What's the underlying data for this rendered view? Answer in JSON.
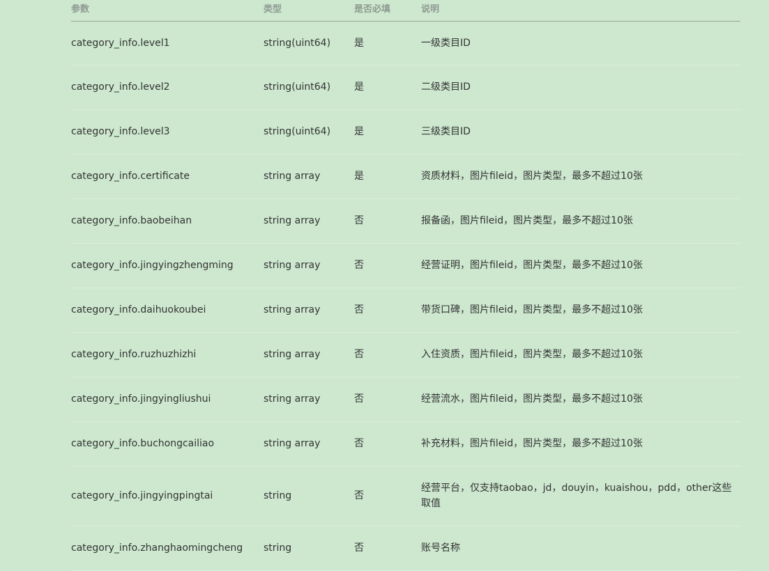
{
  "table": {
    "headers": [
      "参数",
      "类型",
      "是否必填",
      "说明"
    ],
    "rows": [
      {
        "param": "category_info.level1",
        "type": "string(uint64)",
        "required": "是",
        "desc": "一级类目ID"
      },
      {
        "param": "category_info.level2",
        "type": "string(uint64)",
        "required": "是",
        "desc": "二级类目ID"
      },
      {
        "param": "category_info.level3",
        "type": "string(uint64)",
        "required": "是",
        "desc": "三级类目ID"
      },
      {
        "param": "category_info.certificate",
        "type": "string array",
        "required": "是",
        "desc": "资质材料，图片fileid，图片类型，最多不超过10张"
      },
      {
        "param": "category_info.baobeihan",
        "type": "string array",
        "required": "否",
        "desc": "报备函，图片fileid，图片类型，最多不超过10张"
      },
      {
        "param": "category_info.jingyingzhengming",
        "type": "string array",
        "required": "否",
        "desc": "经营证明，图片fileid，图片类型，最多不超过10张"
      },
      {
        "param": "category_info.daihuokoubei",
        "type": "string array",
        "required": "否",
        "desc": "带货口碑，图片fileid，图片类型，最多不超过10张"
      },
      {
        "param": "category_info.ruzhuzhizhi",
        "type": "string array",
        "required": "否",
        "desc": "入住资质，图片fileid，图片类型，最多不超过10张"
      },
      {
        "param": "category_info.jingyingliushui",
        "type": "string array",
        "required": "否",
        "desc": "经营流水，图片fileid，图片类型，最多不超过10张"
      },
      {
        "param": "category_info.buchongcailiao",
        "type": "string array",
        "required": "否",
        "desc": "补充材料，图片fileid，图片类型，最多不超过10张"
      },
      {
        "param": "category_info.jingyingpingtai",
        "type": "string",
        "required": "否",
        "desc": "经营平台，仅支持taobao，jd，douyin，kuaishou，pdd，other这些取值"
      },
      {
        "param": "category_info.zhanghaomingcheng",
        "type": "string",
        "required": "否",
        "desc": "账号名称"
      }
    ]
  }
}
